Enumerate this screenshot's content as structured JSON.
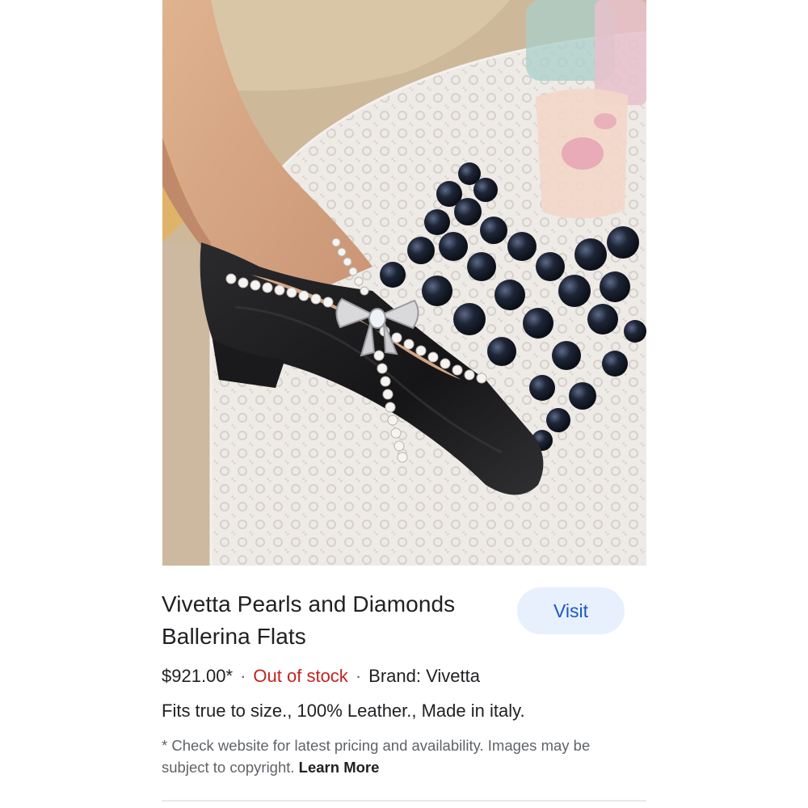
{
  "product": {
    "title": "Vivetta Pearls and Diamonds Ballerina Flats",
    "image_alt": "Black leather block-heel ballerina flat with crossed pearl straps and a crystal bow beside dark grapes on a lace tablecloth",
    "price": "$921.00*",
    "separator": "·",
    "stock_status": "Out of stock",
    "brand": "Brand: Vivetta",
    "description": "Fits true to size., 100% Leather., Made in italy."
  },
  "actions": {
    "visit_label": "Visit"
  },
  "disclaimer": {
    "text": "* Check website for latest pricing and availability. Images may be subject to copyright. ",
    "learn_more_label": "Learn More"
  },
  "colors": {
    "stock_status": "#c5221f",
    "visit_button_bg": "#e8f0fe",
    "visit_button_text": "#1a57c8"
  }
}
